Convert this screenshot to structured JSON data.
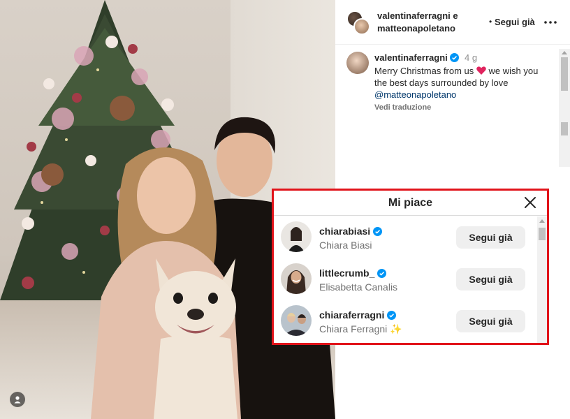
{
  "post_header": {
    "names_line1": "valentinaferragni e",
    "names_line2": "matteonapoletano",
    "dot": "•",
    "follow_label": "Segui già",
    "more_icon": "more-horizontal-icon"
  },
  "caption": {
    "username": "valentinaferragni",
    "time": "4 g",
    "text_before": "Merry Christmas from us ",
    "emoji": "❤️",
    "text_after": " we wish you the best days surrounded by love ",
    "mention": "@matteonapoletano",
    "translate_label": "Vedi traduzione"
  },
  "likes_modal": {
    "title": "Mi piace",
    "close_icon": "close-icon",
    "users": [
      {
        "username": "chiarabiasi",
        "full_name": "Chiara Biasi",
        "button": "Segui già",
        "verified": true
      },
      {
        "username": "littlecrumb_",
        "full_name": "Elisabetta Canalis",
        "button": "Segui già",
        "verified": true
      },
      {
        "username": "chiaraferragni",
        "full_name": "Chiara Ferragni ✨",
        "button": "Segui già",
        "verified": true
      }
    ]
  },
  "colors": {
    "verified_blue": "#0095f6",
    "highlight_red": "#e1131a",
    "button_grey": "#efefef",
    "heart_red": "#e0245e"
  }
}
